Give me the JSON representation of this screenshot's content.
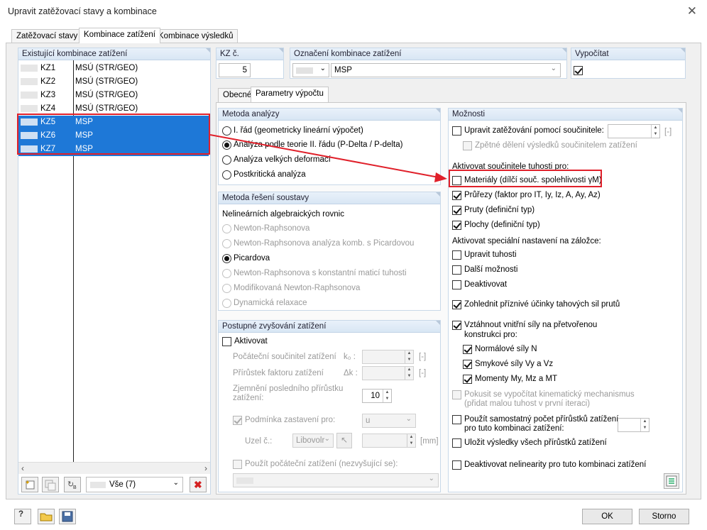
{
  "window": {
    "title": "Upravit zatěžovací stavy a kombinace"
  },
  "tabs": [
    "Zatěžovací stavy",
    "Kombinace zatížení",
    "Kombinace výsledků"
  ],
  "left": {
    "header": "Existující kombinace zatížení",
    "rows": [
      {
        "id": "KZ1",
        "name": "MSÚ (STR/GEO)"
      },
      {
        "id": "KZ2",
        "name": "MSÚ (STR/GEO)"
      },
      {
        "id": "KZ3",
        "name": "MSÚ (STR/GEO)"
      },
      {
        "id": "KZ4",
        "name": "MSÚ (STR/GEO)"
      },
      {
        "id": "KZ5",
        "name": "MSP"
      },
      {
        "id": "KZ6",
        "name": "MSP"
      },
      {
        "id": "KZ7",
        "name": "MSP"
      }
    ],
    "filter_value": "Vše (7)"
  },
  "top": {
    "kz_label": "KZ č.",
    "kz_value": "5",
    "name_label": "Označení kombinace zatížení",
    "name_value": "MSP",
    "calc_label": "Vypočítat"
  },
  "subtabs": [
    "Obecné",
    "Parametry výpočtu"
  ],
  "analysis": {
    "header": "Metoda analýzy",
    "options": [
      "I. řád (geometricky lineární výpočet)",
      "Analýza podle teorie II. řádu (P-Delta / P-delta)",
      "Analýza velkých deformací",
      "Postkritická analýza"
    ]
  },
  "solver": {
    "header": "Metoda řešení soustavy",
    "sub": "Nelineárních algebraických rovnic",
    "options": [
      "Newton-Raphsonova",
      "Newton-Raphsonova analýza komb. s Picardovou",
      "Picardova",
      "Newton-Raphsonova s konstantní maticí tuhosti",
      "Modifikovaná Newton-Raphsonova",
      "Dynamická relaxace"
    ]
  },
  "incr": {
    "header": "Postupné zvyšování zatížení",
    "active": "Aktivovat",
    "f1": "Počáteční součinitel zatížení",
    "s1": "k₀ :",
    "u1": "[-]",
    "f2": "Přírůstek faktoru zatížení",
    "s2": "Δk :",
    "u2": "[-]",
    "f3": "Zjemnění posledního přírůstku zatížení:",
    "v3": "10",
    "stop": "Podmínka zastavení pro:",
    "stop_val": "u",
    "node": "Uzel č.:",
    "node_val": "Libovolr",
    "u4": "[mm]",
    "init": "Použít počáteční zatížení (nezvyšující se):"
  },
  "options": {
    "header": "Možnosti",
    "o1": "Upravit zatěžování pomocí součinitele:",
    "o1u": "[-]",
    "o2": "Zpětné dělení výsledků součinitelem zatížení",
    "g1": "Aktivovat součinitele tuhosti pro:",
    "m1": "Materiály (dílčí souč. spolehlivosti γM)",
    "m2": "Průřezy (faktor pro IT, Iy, Iz, A, Ay, Az)",
    "m3": "Pruty (definiční typ)",
    "m4": "Plochy (definiční typ)",
    "g2": "Aktivovat speciální nastavení na záložce:",
    "s1": "Upravit tuhosti",
    "s2": "Další možnosti",
    "s3": "Deaktivovat",
    "t1": "Zohlednit příznivé účinky tahových sil prutů",
    "t2a": "Vztáhnout vnitřní síly na přetvořenou",
    "t2b": "konstrukci pro:",
    "n1": "Normálové síly N",
    "n2": "Smykové síly Vy a Vz",
    "n3": "Momenty My, Mz a MT",
    "k1": "Pokusit se vypočítat kinematický mechanismus",
    "k2": "(přidat malou tuhost v první iteraci)",
    "p1": "Použít samostatný počet přírůstků zatížení",
    "p2": "pro tuto kombinaci zatížení:",
    "r1": "Uložit výsledky všech přírůstků zatížení",
    "d1": "Deaktivovat nelinearity pro tuto kombinaci zatížení"
  },
  "footer": {
    "ok": "OK",
    "cancel": "Storno"
  },
  "colors": {
    "selection": "#1e78d7",
    "highlight": "#e0202a"
  }
}
